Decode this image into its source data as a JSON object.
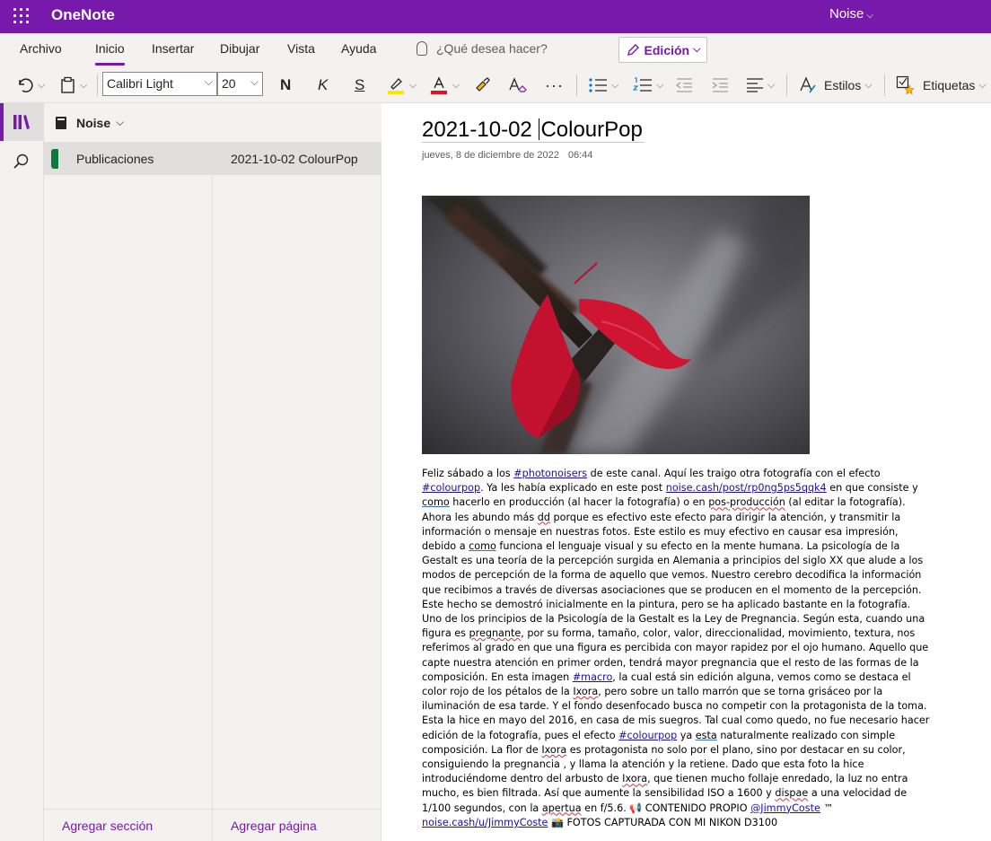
{
  "app": {
    "name": "OneNote",
    "user_notebook": "Noise"
  },
  "ribbon": {
    "tabs": [
      "Archivo",
      "Inicio",
      "Insertar",
      "Dibujar",
      "Vista",
      "Ayuda"
    ],
    "active_tab": "Inicio",
    "tell_me_placeholder": "¿Qué desea hacer?",
    "mode_button": "Edición",
    "font_name": "Calibri Light",
    "font_size": "20",
    "bold": "N",
    "italic": "K",
    "underline": "S",
    "styles_label": "Estilos",
    "tags_label": "Etiquetas",
    "more": "···"
  },
  "navigator": {
    "notebook": "Noise",
    "sections": [
      "Publicaciones"
    ],
    "pages": [
      "2021-10-02 ColourPop"
    ],
    "add_section": "Agregar sección",
    "add_page": "Agregar página"
  },
  "page": {
    "title_a": "2021-10-02 ",
    "title_b": "ColourPop",
    "date": "jueves, 8 de diciembre de 2022",
    "time": "06:44",
    "body": {
      "s1": "Feliz sábado a los ",
      "l1": "#photonoisers",
      "s2": " de este canal. Aquí les traigo otra fotografía con el efecto ",
      "l2": "#colourpop",
      "s3": ". Ya les había explicado en este post ",
      "l3": "noise.cash/post/rp0ng5ps5qqk4",
      "s4": " en que consiste y ",
      "w1": "como",
      "s5": " hacerlo en producción (al hacer la fotografía) o en ",
      "w2": "pos-producción",
      "s6": " (al editar la fotografía). Ahora les abundo más ",
      "w3": "dd",
      "s7": " porque es efectivo este efecto para dirigir la atención, y transmitir la información o mensaje en nuestras fotos. Este estilo es muy efectivo en causar esa impresión, debido a ",
      "w4": "como",
      "s8": " funciona el lenguaje visual y su efecto en la mente humana. La psicología de la Gestalt es una teoría de la percepción surgida en Alemania a principios del siglo XX que alude a los modos de percepción de la forma de aquello que vemos. Nuestro cerebro decodifica la información que recibimos a través de diversas asociaciones que se producen en el momento de la percepción. Este hecho se demostró inicialmente en la pintura, pero se ha aplicado bastante en la fotografía. Uno de los principios de la Psicología de la Gestalt es la Ley de Pregnancia. Según esta, cuando una figura es ",
      "w5": "pregnante",
      "s9": ", por su forma, tamaño, color, valor, direccionalidad, movimiento, textura, nos referimos al grado en que una figura es percibida con mayor rapidez por el ojo humano. Aquello que capte nuestra atención en primer orden, tendrá mayor pregnancia que el resto de las formas de la composición. En esta imagen ",
      "l4": "#macro",
      "s10": ", la cual está sin edición alguna, vemos como se destaca el color rojo de los pétalos de la ",
      "w6": "Ixora",
      "s11": ", pero sobre un tallo marrón que se torna grisáceo por la iluminación de esa tarde. Y el fondo desenfocado busca no competir con la protagonista de la toma. Esta la hice en mayo del 2016, en casa de mis suegros. Tal cual como quedo, no fue necesario hacer edición de la fotografía, pues el efecto ",
      "l5": "#colourpop",
      "s12": " ya ",
      "w7": "esta",
      "s13": " naturalmente realizado con simple composición. La flor de ",
      "w8": "Ixora",
      "s14": " es protagonista no solo por el plano, sino por destacar en su color, consiguiendo la pregnancia , y llama la atención y la retiene. Dado que esta foto la hice introduciéndome dentro del arbusto de ",
      "w9": "Ixora",
      "s15": ", que tienen mucho follaje enredado, la luz no entra mucho, es bien filtrada. Así que aumente la sensibilidad ISO a 1600 y ",
      "w10": "dispae",
      "s16": " a una velocidad de 1/100 segundos, con la ",
      "w11": "apertua",
      "s17": " en f/5.6. 📢 CONTENIDO PROPIO ",
      "l6": "@JimmyCoste",
      "s18": " ™ ",
      "l7": "noise.cash/u/JimmyCoste",
      "s19": " 📸 FOTOS CAPTURADA CON MI NIKON D3100"
    }
  },
  "colors": {
    "brand": "#7719aa",
    "link": "#1a0dab",
    "section_tab": "#0b7a3e"
  }
}
